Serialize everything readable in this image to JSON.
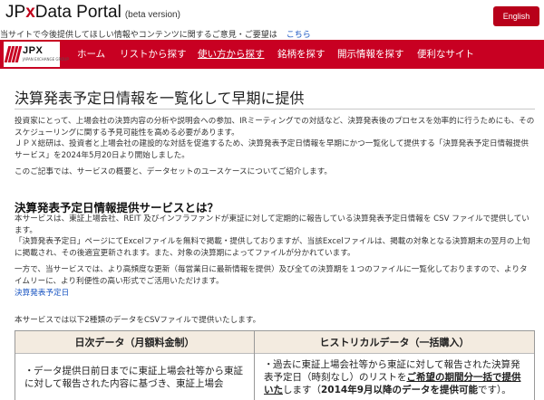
{
  "header": {
    "title_prefix": "JP",
    "title_x": "x",
    "title_suffix": "Data Portal",
    "beta": "(beta version)",
    "english_button": "English",
    "notice_text": "当サイトで今後提供してほしい情報やコンテンツに関するご意見・ご要望は",
    "notice_link": "こちら"
  },
  "logo": {
    "text": "JPX",
    "sub": "JAPAN EXCHANGE GROUP"
  },
  "nav": {
    "items": [
      {
        "label": "ホーム"
      },
      {
        "label": "リストから探す"
      },
      {
        "label": "使い方から探す"
      },
      {
        "label": "銘柄を探す"
      },
      {
        "label": "開示情報を探す"
      },
      {
        "label": "便利なサイト"
      }
    ]
  },
  "page": {
    "title": "決算発表予定日情報を一覧化して早期に提供",
    "intro_1": "投資家にとって、上場会社の決算内容の分析や説明会への参加、IRミーティングでの対話など、決算発表後のプロセスを効率的に行うためにも、そのスケジューリングに関する予見可能性を高める必要があります。",
    "intro_2": "ＪＰＸ総研は、投資者と上場会社の建設的な対話を促進するため、決算発表予定日情報を早期にかつ一覧化して提供する「決算発表予定日情報提供サービス」を2024年5月20日より開始しました。",
    "intro_3": "このご記事では、サービスの概要と、データセットのユースケースについてご紹介します。",
    "section_title": "決算発表予定日情報提供サービスとは？",
    "body_1": "本サービスは、東証上場会社、REIT 及びインフラファンドが東証に対して定期的に報告している決算発表予定日情報を CSV ファイルで提供しています。",
    "body_2": "「決算発表予定日」ページにてExcelファイルを無料で掲載・提供しておりますが、当該Excelファイルは、掲載の対象となる決算期末の翌月の上旬に掲載され、その後適宜更新されます。また、対象の決算期によってファイルが分かれています。",
    "body_3": "一方で、当サービスでは、より高頻度な更新（毎営業日に最新情報を提供）及び全ての決算期を１つのファイルに一覧化しておりますので、よりタイムリーに、より利便性の高い形式でご活用いただけます。",
    "body_link": "決算発表予定日",
    "body_4": "本サービスでは以下2種類のデータをCSVファイルで提供いたします。"
  },
  "table": {
    "left_header": "日次データ（月額料金制）",
    "left_bullet": "・",
    "left_text": "データ提供日前日までに東証上場会社等から東証に対して報告された内容に基づき、東証上場会",
    "right_header": "ヒストリカルデータ（一括購入）",
    "right_bullet": "・",
    "right_text_1": "過去に東証上場会社等から東証に対して報告された決算発表予定日（時刻なし）のリストを",
    "right_text_2": "ご希望の期間分一括で提供いた",
    "right_text_3": "します（",
    "right_text_4": "2014年9月以降のデータを提供可能",
    "right_text_5": "です）。"
  }
}
